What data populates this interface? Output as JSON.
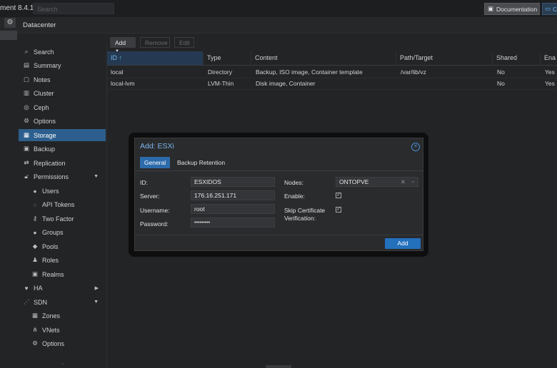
{
  "topbar": {
    "title": "ment 8.4.1",
    "search_placeholder": "Search",
    "documentation_label": "Documentation",
    "create_vm_label": "C"
  },
  "breadcrumb": "Datacenter",
  "nav": {
    "items": [
      {
        "label": "Search",
        "icon": "search-icon"
      },
      {
        "label": "Summary",
        "icon": "book-icon"
      },
      {
        "label": "Notes",
        "icon": "note-icon"
      },
      {
        "label": "Cluster",
        "icon": "server-icon"
      },
      {
        "label": "Ceph",
        "icon": "ceph-icon"
      },
      {
        "label": "Options",
        "icon": "gear-icon"
      },
      {
        "label": "Storage",
        "icon": "database-icon"
      },
      {
        "label": "Backup",
        "icon": "floppy-icon"
      },
      {
        "label": "Replication",
        "icon": "retweet-icon"
      },
      {
        "label": "Permissions",
        "icon": "unlock-icon"
      },
      {
        "label": "Users",
        "icon": "user-icon"
      },
      {
        "label": "API Tokens",
        "icon": "user-tag-icon"
      },
      {
        "label": "Two Factor",
        "icon": "key-icon"
      },
      {
        "label": "Groups",
        "icon": "users-icon"
      },
      {
        "label": "Pools",
        "icon": "tags-icon"
      },
      {
        "label": "Roles",
        "icon": "male-icon"
      },
      {
        "label": "Realms",
        "icon": "address-book-icon"
      },
      {
        "label": "HA",
        "icon": "heartbeat-icon"
      },
      {
        "label": "SDN",
        "icon": "sdn-icon"
      },
      {
        "label": "Zones",
        "icon": "th-icon"
      },
      {
        "label": "VNets",
        "icon": "sitemap-icon"
      },
      {
        "label": "Options",
        "icon": "gear-icon"
      }
    ]
  },
  "toolbar": {
    "add_label": "Add",
    "remove_label": "Remove",
    "edit_label": "Edit"
  },
  "grid": {
    "columns": [
      "ID",
      "Type",
      "Content",
      "Path/Target",
      "Shared",
      "Ena"
    ],
    "rows": [
      [
        "local",
        "Directory",
        "Backup, ISO image, Container template",
        "/var/lib/vz",
        "No",
        "Yes"
      ],
      [
        "local-lvm",
        "LVM-Thin",
        "Disk image, Container",
        "",
        "No",
        "Yes"
      ]
    ]
  },
  "dialog": {
    "title": "Add: ESXi",
    "tabs": [
      "General",
      "Backup Retention"
    ],
    "fields": {
      "id_label": "ID:",
      "id_value": "ESXIDOS",
      "server_label": "Server:",
      "server_value": "176.16.251.171",
      "username_label": "Username:",
      "username_value": "root",
      "password_label": "Password:",
      "password_value": "•••••••••",
      "nodes_label": "Nodes:",
      "nodes_value": "ONTOPVE",
      "enable_label": "Enable:",
      "enable_checked": true,
      "skip_cert_label_1": "Skip Certificate",
      "skip_cert_label_2": "Verification:",
      "skip_cert_checked": true
    },
    "add_button_label": "Add"
  },
  "colors": {
    "accent": "#2c6bab",
    "active_nav": "#2c5f8e",
    "background": "#232426",
    "dialog_title": "#7ab6ee"
  }
}
